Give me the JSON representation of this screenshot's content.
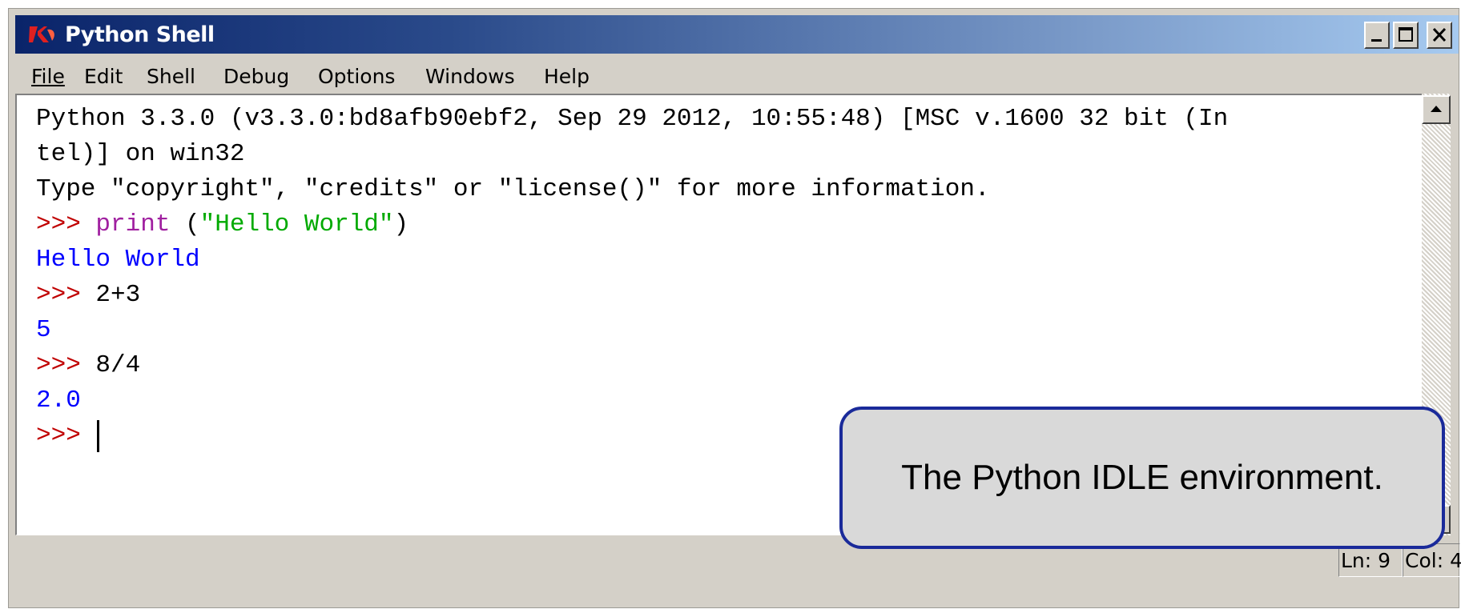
{
  "window": {
    "title": "Python Shell",
    "app_icon": "tk-feather-icon"
  },
  "title_buttons": [
    "minimize-icon",
    "maximize-icon",
    "close-icon"
  ],
  "menu": [
    {
      "label": "File"
    },
    {
      "label": "Edit"
    },
    {
      "label": "Shell"
    },
    {
      "label": "Debug"
    },
    {
      "label": "Options"
    },
    {
      "label": "Windows"
    },
    {
      "label": "Help"
    }
  ],
  "shell": {
    "banner_line1": "Python 3.3.0 (v3.3.0:bd8afb90ebf2, Sep 29 2012, 10:55:48) [MSC v.1600 32 bit (In",
    "banner_line2": "tel)] on win32",
    "banner_line3": "Type \"copyright\", \"credits\" or \"license()\" for more information.",
    "prompt": ">>> ",
    "cmd1_keyword": "print",
    "cmd1_rest_open": " (",
    "cmd1_string": "\"Hello World\"",
    "cmd1_close": ")",
    "out1": "Hello World",
    "cmd2": "2+3",
    "out2": "5",
    "cmd3": "8/4",
    "out3": "2.0"
  },
  "status": {
    "line": "Ln: 9",
    "col": "Col: 4"
  },
  "callout": {
    "text": "The Python IDLE environment."
  },
  "colors": {
    "prompt": "#c00000",
    "keyword": "#a020a0",
    "string": "#00aa00",
    "output": "#0000ff",
    "callout_border": "#1a2a9a"
  }
}
